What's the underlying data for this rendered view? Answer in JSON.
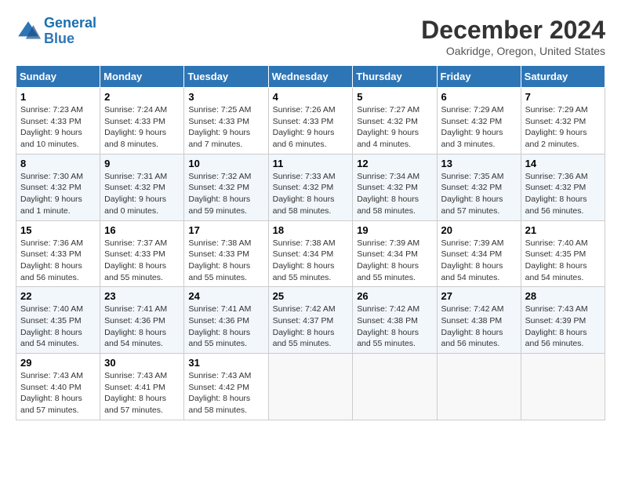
{
  "header": {
    "logo_line1": "General",
    "logo_line2": "Blue",
    "month": "December 2024",
    "location": "Oakridge, Oregon, United States"
  },
  "weekdays": [
    "Sunday",
    "Monday",
    "Tuesday",
    "Wednesday",
    "Thursday",
    "Friday",
    "Saturday"
  ],
  "weeks": [
    [
      {
        "day": "1",
        "sunrise": "7:23 AM",
        "sunset": "4:33 PM",
        "daylight": "9 hours and 10 minutes."
      },
      {
        "day": "2",
        "sunrise": "7:24 AM",
        "sunset": "4:33 PM",
        "daylight": "9 hours and 8 minutes."
      },
      {
        "day": "3",
        "sunrise": "7:25 AM",
        "sunset": "4:33 PM",
        "daylight": "9 hours and 7 minutes."
      },
      {
        "day": "4",
        "sunrise": "7:26 AM",
        "sunset": "4:33 PM",
        "daylight": "9 hours and 6 minutes."
      },
      {
        "day": "5",
        "sunrise": "7:27 AM",
        "sunset": "4:32 PM",
        "daylight": "9 hours and 4 minutes."
      },
      {
        "day": "6",
        "sunrise": "7:29 AM",
        "sunset": "4:32 PM",
        "daylight": "9 hours and 3 minutes."
      },
      {
        "day": "7",
        "sunrise": "7:29 AM",
        "sunset": "4:32 PM",
        "daylight": "9 hours and 2 minutes."
      }
    ],
    [
      {
        "day": "8",
        "sunrise": "7:30 AM",
        "sunset": "4:32 PM",
        "daylight": "9 hours and 1 minute."
      },
      {
        "day": "9",
        "sunrise": "7:31 AM",
        "sunset": "4:32 PM",
        "daylight": "9 hours and 0 minutes."
      },
      {
        "day": "10",
        "sunrise": "7:32 AM",
        "sunset": "4:32 PM",
        "daylight": "8 hours and 59 minutes."
      },
      {
        "day": "11",
        "sunrise": "7:33 AM",
        "sunset": "4:32 PM",
        "daylight": "8 hours and 58 minutes."
      },
      {
        "day": "12",
        "sunrise": "7:34 AM",
        "sunset": "4:32 PM",
        "daylight": "8 hours and 58 minutes."
      },
      {
        "day": "13",
        "sunrise": "7:35 AM",
        "sunset": "4:32 PM",
        "daylight": "8 hours and 57 minutes."
      },
      {
        "day": "14",
        "sunrise": "7:36 AM",
        "sunset": "4:32 PM",
        "daylight": "8 hours and 56 minutes."
      }
    ],
    [
      {
        "day": "15",
        "sunrise": "7:36 AM",
        "sunset": "4:33 PM",
        "daylight": "8 hours and 56 minutes."
      },
      {
        "day": "16",
        "sunrise": "7:37 AM",
        "sunset": "4:33 PM",
        "daylight": "8 hours and 55 minutes."
      },
      {
        "day": "17",
        "sunrise": "7:38 AM",
        "sunset": "4:33 PM",
        "daylight": "8 hours and 55 minutes."
      },
      {
        "day": "18",
        "sunrise": "7:38 AM",
        "sunset": "4:34 PM",
        "daylight": "8 hours and 55 minutes."
      },
      {
        "day": "19",
        "sunrise": "7:39 AM",
        "sunset": "4:34 PM",
        "daylight": "8 hours and 55 minutes."
      },
      {
        "day": "20",
        "sunrise": "7:39 AM",
        "sunset": "4:34 PM",
        "daylight": "8 hours and 54 minutes."
      },
      {
        "day": "21",
        "sunrise": "7:40 AM",
        "sunset": "4:35 PM",
        "daylight": "8 hours and 54 minutes."
      }
    ],
    [
      {
        "day": "22",
        "sunrise": "7:40 AM",
        "sunset": "4:35 PM",
        "daylight": "8 hours and 54 minutes."
      },
      {
        "day": "23",
        "sunrise": "7:41 AM",
        "sunset": "4:36 PM",
        "daylight": "8 hours and 54 minutes."
      },
      {
        "day": "24",
        "sunrise": "7:41 AM",
        "sunset": "4:36 PM",
        "daylight": "8 hours and 55 minutes."
      },
      {
        "day": "25",
        "sunrise": "7:42 AM",
        "sunset": "4:37 PM",
        "daylight": "8 hours and 55 minutes."
      },
      {
        "day": "26",
        "sunrise": "7:42 AM",
        "sunset": "4:38 PM",
        "daylight": "8 hours and 55 minutes."
      },
      {
        "day": "27",
        "sunrise": "7:42 AM",
        "sunset": "4:38 PM",
        "daylight": "8 hours and 56 minutes."
      },
      {
        "day": "28",
        "sunrise": "7:43 AM",
        "sunset": "4:39 PM",
        "daylight": "8 hours and 56 minutes."
      }
    ],
    [
      {
        "day": "29",
        "sunrise": "7:43 AM",
        "sunset": "4:40 PM",
        "daylight": "8 hours and 57 minutes."
      },
      {
        "day": "30",
        "sunrise": "7:43 AM",
        "sunset": "4:41 PM",
        "daylight": "8 hours and 57 minutes."
      },
      {
        "day": "31",
        "sunrise": "7:43 AM",
        "sunset": "4:42 PM",
        "daylight": "8 hours and 58 minutes."
      },
      null,
      null,
      null,
      null
    ]
  ]
}
